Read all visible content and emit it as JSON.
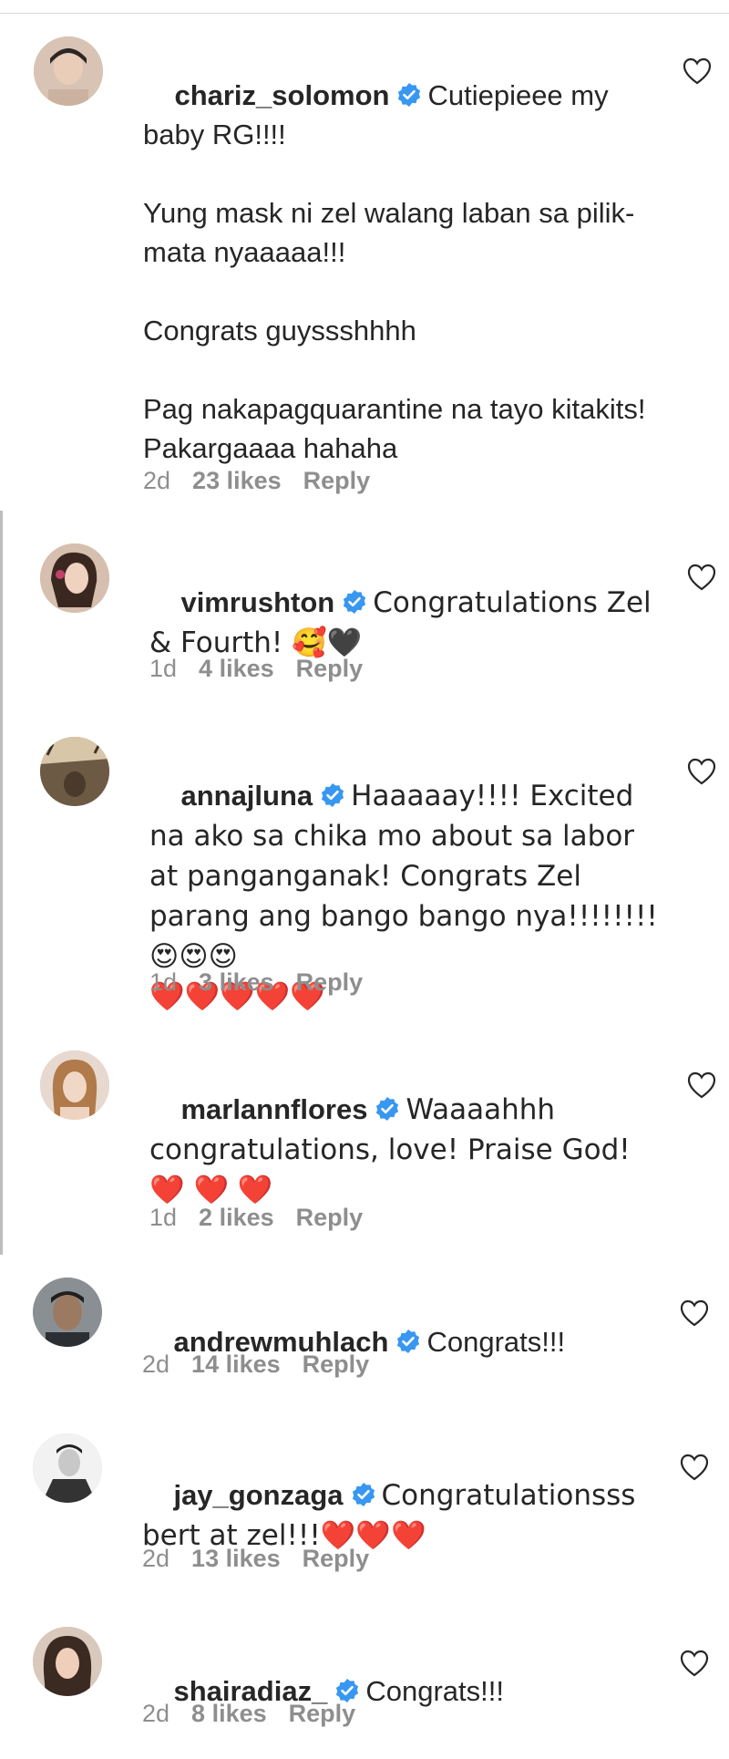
{
  "colors": {
    "verified_blue": "#3897f0",
    "meta_gray": "#8e8e8e",
    "text": "#262626",
    "heart_red": "#ed1c3a"
  },
  "comments": [
    {
      "username": "chariz_solomon",
      "text": "Cutiepieee my baby RG!!!!\n\nYung mask ni zel walang laban sa pilik-mata nyaaaaa!!!\n\nCongrats guyssshhhh\n\nPag nakapagquarantine na tayo kitakits! Pakargaaaa hahaha",
      "time": "2d",
      "likes": "23 likes",
      "reply": "Reply"
    },
    {
      "username": "vimrushton",
      "text": "Congratulations Zel & Fourth! 🥰🖤",
      "time": "1d",
      "likes": "4 likes",
      "reply": "Reply"
    },
    {
      "username": "annajluna",
      "text": "Haaaaay!!!! Excited na ako sa chika mo about sa labor at panganganak! Congrats Zel parang ang bango bango nya!!!!!!!! 😍😍😍\n❤️❤️❤️❤️❤️",
      "time": "1d",
      "likes": "3 likes",
      "reply": "Reply"
    },
    {
      "username": "marlannflores",
      "text": "Waaaahhh congratulations, love! Praise God!\n❤️ ❤️ ❤️",
      "time": "1d",
      "likes": "2 likes",
      "reply": "Reply"
    },
    {
      "username": "andrewmuhlach",
      "text": "Congrats!!!",
      "time": "2d",
      "likes": "14 likes",
      "reply": "Reply"
    },
    {
      "username": "jay_gonzaga",
      "text": "Congratulationsss bert at zel!!!❤️❤️❤️",
      "time": "2d",
      "likes": "13 likes",
      "reply": "Reply"
    },
    {
      "username": "shairadiaz_",
      "text": "Congrats!!!",
      "time": "2d",
      "likes": "8 likes",
      "reply": "Reply"
    }
  ]
}
